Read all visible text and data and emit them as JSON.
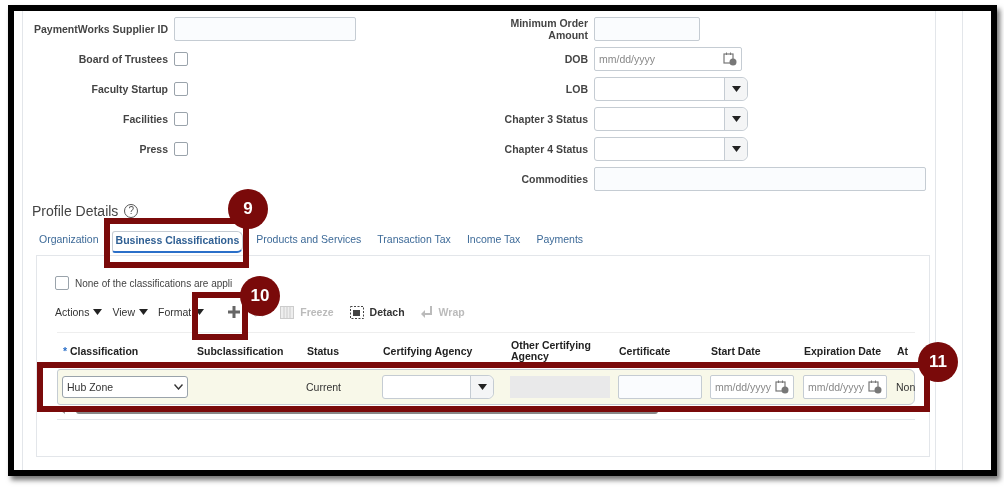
{
  "form_left": [
    {
      "label": "PaymentWorks Supplier ID",
      "kind": "text"
    },
    {
      "label": "Board of Trustees",
      "kind": "checkbox",
      "checked": false
    },
    {
      "label": "Faculty Startup",
      "kind": "checkbox",
      "checked": false
    },
    {
      "label": "Facilities",
      "kind": "checkbox",
      "checked": false
    },
    {
      "label": "Press",
      "kind": "checkbox",
      "checked": false
    }
  ],
  "form_right": [
    {
      "label": "Minimum Order Amount",
      "kind": "short"
    },
    {
      "label": "DOB",
      "kind": "date",
      "placeholder": "mm/dd/yyyy"
    },
    {
      "label": "LOB",
      "kind": "select"
    },
    {
      "label": "Chapter 3 Status",
      "kind": "select"
    },
    {
      "label": "Chapter 4 Status",
      "kind": "select"
    },
    {
      "label": "Commodities",
      "kind": "wide"
    }
  ],
  "section": {
    "title": "Profile Details",
    "help": "?"
  },
  "tabs": [
    {
      "label": "Organization",
      "selected": false
    },
    {
      "label": "Business Classifications",
      "selected": true
    },
    {
      "label": "Products and Services",
      "selected": false
    },
    {
      "label": "Transaction Tax",
      "selected": false
    },
    {
      "label": "Income Tax",
      "selected": false
    },
    {
      "label": "Payments",
      "selected": false
    }
  ],
  "none_checkbox": {
    "label": "None of the classifications are appli",
    "checked": false
  },
  "toolbar": {
    "menus": [
      "Actions",
      "View",
      "Format"
    ],
    "buttons": [
      {
        "label": "Freeze",
        "kind": "freeze",
        "disabled": true
      },
      {
        "label": "Detach",
        "kind": "detach",
        "disabled": false
      },
      {
        "label": "Wrap",
        "kind": "wrap",
        "disabled": true
      }
    ]
  },
  "table": {
    "columns": [
      {
        "label": "Classification",
        "marker": "*"
      },
      {
        "label": "Subclassification"
      },
      {
        "label": "Status"
      },
      {
        "label": "Certifying Agency"
      },
      {
        "label": "Other Certifying Agency"
      },
      {
        "label": "Certificate"
      },
      {
        "label": "Start Date"
      },
      {
        "label": "Expiration Date"
      },
      {
        "label": "At"
      }
    ],
    "rows": [
      {
        "selected": true,
        "cells": [
          {
            "kind": "select",
            "value": "Hub Zone"
          },
          {
            "kind": "empty"
          },
          {
            "kind": "text",
            "value": "Current"
          },
          {
            "kind": "combo"
          },
          {
            "kind": "readonly"
          },
          {
            "kind": "input"
          },
          {
            "kind": "date",
            "placeholder": "mm/dd/yyyy"
          },
          {
            "kind": "date",
            "placeholder": "mm/dd/yyyy"
          },
          {
            "kind": "text",
            "value": "Non"
          }
        ]
      }
    ]
  },
  "callouts": [
    {
      "number": "9"
    },
    {
      "number": "10"
    },
    {
      "number": "11"
    }
  ]
}
